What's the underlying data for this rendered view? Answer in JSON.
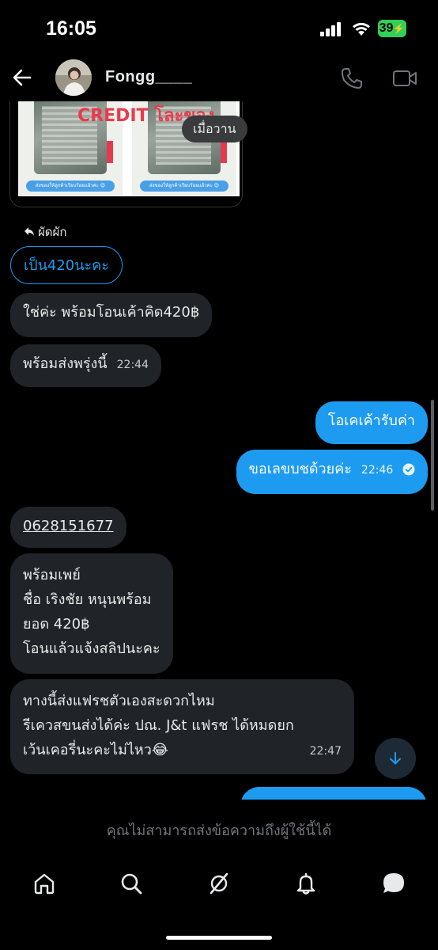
{
  "status_bar": {
    "time": "16:05",
    "battery": "39"
  },
  "header": {
    "contact_name": "Fongg____"
  },
  "image_message": {
    "overlay_text": "CREDIT โละของ",
    "timestamp_chip": "เมื่อวาน",
    "caption_left": "ส่งของให้ลูกค้าเรียบร้อยแล้วค่ะ 😍",
    "caption_right": "ส่งของให้ลูกค้าเรียบร้อยแล้วค่ะ 😍"
  },
  "reply": {
    "indicator_label": "ผัดผัก",
    "quoted_text": "เป็น420นะคะ"
  },
  "messages": [
    {
      "text": "ใช่ค่ะ พร้อมโอนเค้าคิด420฿"
    },
    {
      "text": "พร้อมส่งพรุ่งนี้",
      "time": "22:44"
    },
    {
      "text": "โอเคเค้ารับค่า"
    },
    {
      "text": "ขอเลขบชด้วยค่ะ",
      "time": "22:46"
    },
    {
      "text": "0628151677"
    },
    {
      "lines": [
        "พร้อมเพย์",
        "ชื่อ เริงชัย หนุนพร้อม",
        "ยอด 420฿",
        "โอนแล้วแจ้งสลิปนะคะ"
      ]
    },
    {
      "lines": [
        "ทางนี้ส่งแฟรชตัวเองสะดวกไหม",
        "รีเควสขนส่งได้ค่ะ ปณ. J&t แฟรช ได้หมดยก",
        "เว้นเคอรี่นะคะไม่ไหว😂"
      ],
      "time": "22:47"
    }
  ],
  "footer": {
    "cannot_message": "คุณไม่สามารถส่งข้อความถึงผู้ใช้นี้ได้"
  },
  "colors": {
    "accent": "#1d9bf0",
    "incoming_bubble": "#202327",
    "background": "#000000"
  }
}
